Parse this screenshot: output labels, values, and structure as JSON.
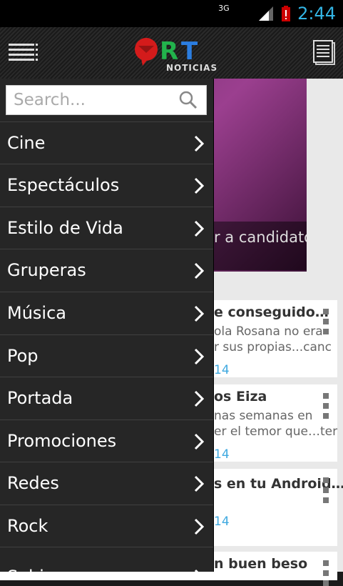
{
  "status": {
    "network": "3G",
    "time": "2:44"
  },
  "app": {
    "logo_text": "NOTICIAS"
  },
  "search": {
    "placeholder": "Search..."
  },
  "categories": [
    {
      "label": "Cine"
    },
    {
      "label": "Espectáculos"
    },
    {
      "label": "Estilo de Vida"
    },
    {
      "label": "Gruperas"
    },
    {
      "label": "Música"
    },
    {
      "label": "Pop"
    },
    {
      "label": "Portada"
    },
    {
      "label": "Promociones"
    },
    {
      "label": "Redes"
    },
    {
      "label": "Rock"
    },
    {
      "label": "Sabias que"
    }
  ],
  "background": {
    "hero_caption": "r a candidato por",
    "cards": [
      {
        "title": "e conseguido…",
        "desc1": "ola Rosana no era",
        "desc2": "r sus propias...canc",
        "num": "14"
      },
      {
        "title": "os Eiza",
        "desc1": "nas semanas en",
        "desc2": "er el temor que…ter",
        "num": "14"
      },
      {
        "title": "s en tu Android…",
        "desc1": "",
        "desc2": "",
        "num": "14"
      },
      {
        "title": "n buen beso",
        "desc1": "",
        "desc2": "",
        "num": ""
      }
    ]
  },
  "colors": {
    "accent": "#33b5e5",
    "drawer_bg": "#262626",
    "link_num": "#3fa9e0"
  }
}
